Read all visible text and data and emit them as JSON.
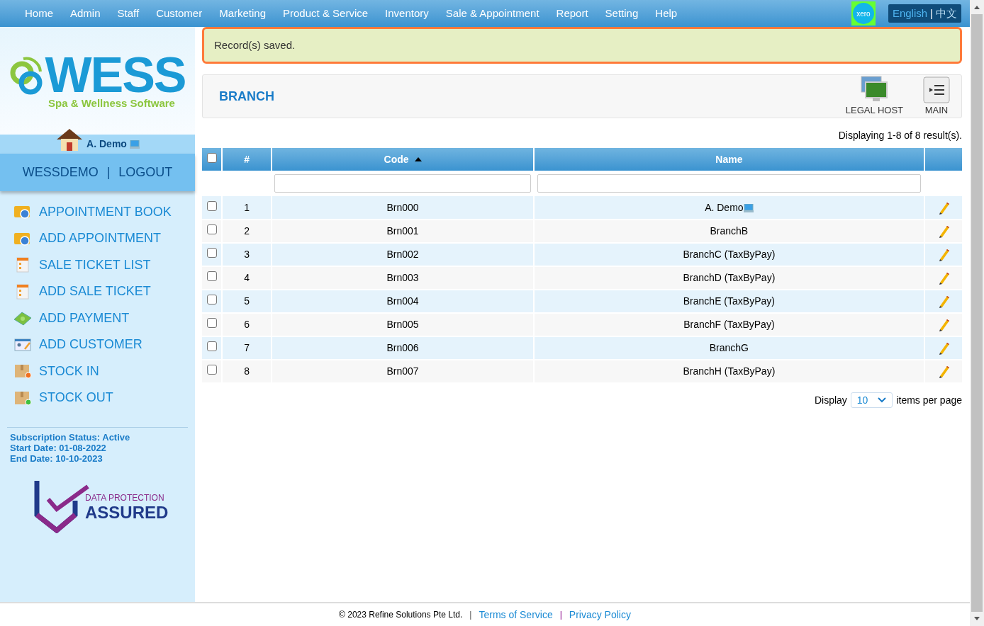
{
  "nav": {
    "items": [
      "Home",
      "Admin",
      "Staff",
      "Customer",
      "Marketing",
      "Product & Service",
      "Inventory",
      "Sale & Appointment",
      "Report",
      "Setting",
      "Help"
    ],
    "xero": "xero",
    "language": {
      "options": [
        {
          "label": "English",
          "selected": true
        },
        {
          "label": "中文",
          "selected": false
        }
      ],
      "separator": "|"
    }
  },
  "sidebar": {
    "logo": {
      "wordmark": "WESS",
      "tagline": "Spa & Wellness Software"
    },
    "user": "A. Demo",
    "account": "WESSDEMO",
    "separator": "|",
    "logout": "LOGOUT",
    "menu": [
      {
        "label": "APPOINTMENT BOOK",
        "kind": "calendar"
      },
      {
        "label": "ADD APPOINTMENT",
        "kind": "calendar"
      },
      {
        "label": "SALE TICKET LIST",
        "kind": "ticket"
      },
      {
        "label": "ADD SALE TICKET",
        "kind": "ticket"
      },
      {
        "label": "ADD PAYMENT",
        "kind": "money"
      },
      {
        "label": "ADD CUSTOMER",
        "kind": "customer"
      },
      {
        "label": "STOCK IN",
        "kind": "stock_in"
      },
      {
        "label": "STOCK OUT",
        "kind": "stock_out"
      }
    ],
    "subscription": [
      "Subscription Status: Active",
      "Start Date: 01-08-2022",
      "End Date: 10-10-2023"
    ],
    "badge": {
      "line1": "DATA PROTECTION",
      "line2": "ASSURED"
    }
  },
  "alert": "Record(s) saved.",
  "page": {
    "title": "BRANCH",
    "actions": [
      {
        "label": "LEGAL HOST",
        "kind": "host"
      },
      {
        "label": "MAIN",
        "kind": "list"
      }
    ]
  },
  "summary": "Displaying 1-8 of 8 result(s).",
  "table": {
    "select_all": false,
    "columns": [
      {
        "label": "#",
        "sorted": false
      },
      {
        "label": "Code",
        "sorted": true
      },
      {
        "label": "Name",
        "sorted": false
      }
    ],
    "rows": [
      {
        "checked": false,
        "index": "1",
        "code": "Brn000",
        "name": "A. Demo",
        "computer": true
      },
      {
        "checked": false,
        "index": "2",
        "code": "Brn001",
        "name": "BranchB",
        "computer": false
      },
      {
        "checked": false,
        "index": "3",
        "code": "Brn002",
        "name": "BranchC (TaxByPay)",
        "computer": false
      },
      {
        "checked": false,
        "index": "4",
        "code": "Brn003",
        "name": "BranchD (TaxByPay)",
        "computer": false
      },
      {
        "checked": false,
        "index": "5",
        "code": "Brn004",
        "name": "BranchE (TaxByPay)",
        "computer": false
      },
      {
        "checked": false,
        "index": "6",
        "code": "Brn005",
        "name": "BranchF (TaxByPay)",
        "computer": false
      },
      {
        "checked": false,
        "index": "7",
        "code": "Brn006",
        "name": "BranchG",
        "computer": false
      },
      {
        "checked": false,
        "index": "8",
        "code": "Brn007",
        "name": "BranchH (TaxByPay)",
        "computer": false
      }
    ]
  },
  "pager": {
    "label": "Display",
    "value": "10",
    "suffix": "items per page"
  },
  "footer": {
    "copyright": "© 2023 Refine Solutions Pte Ltd.",
    "separator": "|",
    "terms": "Terms of Service",
    "privacy": "Privacy Policy"
  }
}
